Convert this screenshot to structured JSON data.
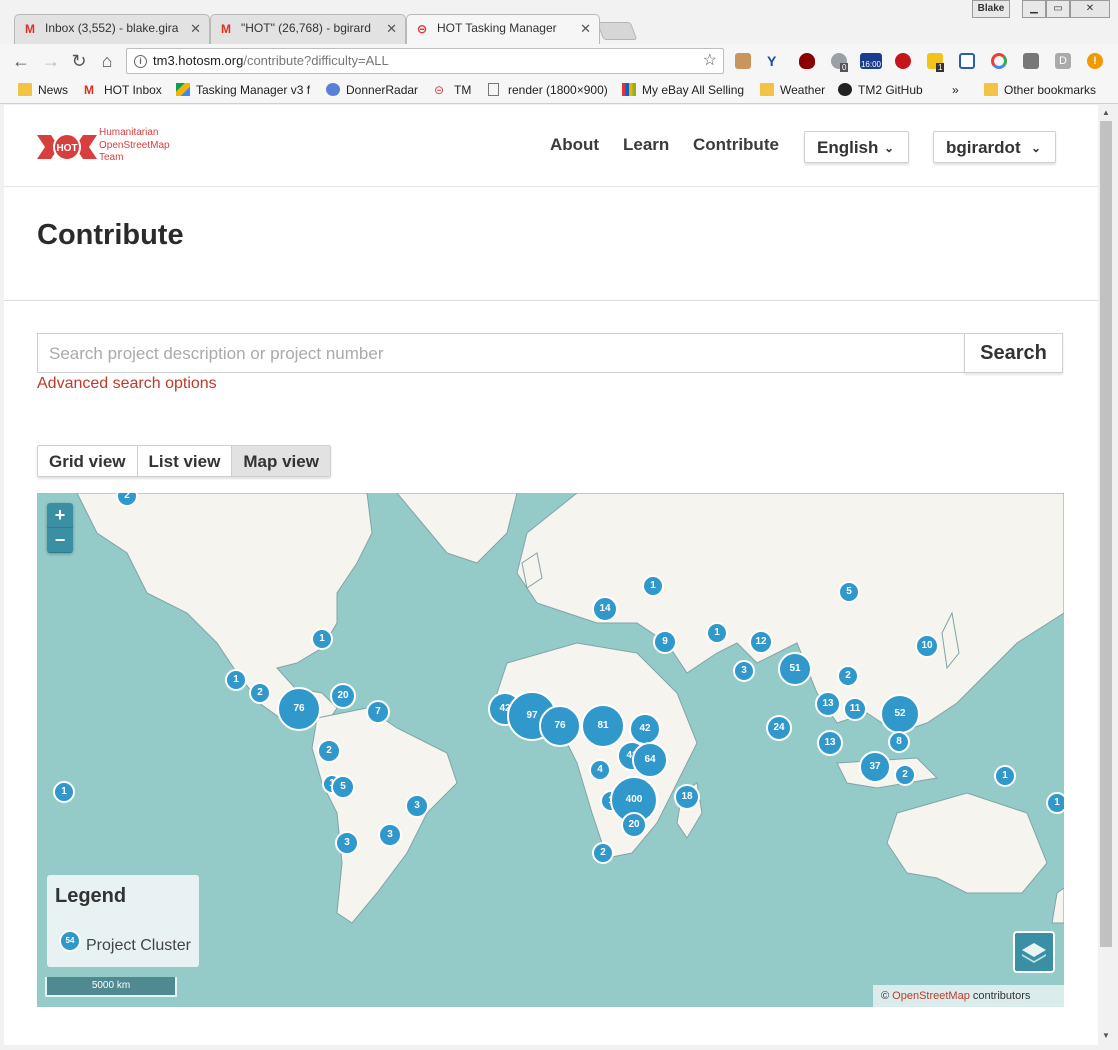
{
  "browser": {
    "tabs": [
      {
        "title": "Inbox (3,552) - blake.gira",
        "favicon": "gmail"
      },
      {
        "title": "\"HOT\" (26,768) - bgirard",
        "favicon": "gmail"
      },
      {
        "title": "HOT Tasking Manager",
        "favicon": "hot"
      }
    ],
    "user_badge": "Blake",
    "url_host": "tm3.hotosm.org",
    "url_path": "/contribute?difficulty=ALL",
    "bookmarks": [
      "News",
      "HOT Inbox",
      "Tasking Manager v3 f",
      "DonnerRadar",
      "TM",
      "render (1800×900)",
      "My eBay All Selling",
      "Weather",
      "TM2 GitHub",
      "»",
      "Other bookmarks"
    ],
    "ext_badges": {
      "counter": "0",
      "clock": "16:00",
      "notes": "1",
      "d": "D"
    }
  },
  "header": {
    "logo_text": [
      "Humanitarian",
      "OpenStreetMap",
      "Team"
    ],
    "logo_abbr": "HOT",
    "nav": [
      "About",
      "Learn",
      "Contribute"
    ],
    "language": "English",
    "user": "bgirardot"
  },
  "page": {
    "title": "Contribute",
    "search_placeholder": "Search project description or project number",
    "search_button": "Search",
    "advanced_link": "Advanced search options",
    "views": [
      "Grid view",
      "List view",
      "Map view"
    ],
    "active_view": "Map view"
  },
  "map": {
    "zoom_in": "+",
    "zoom_out": "−",
    "legend_title": "Legend",
    "legend_label": "Project Cluster",
    "legend_sample": "54",
    "scale": "5000 km",
    "attribution_prefix": "©",
    "attribution_link": "OpenStreetMap",
    "attribution_suffix": "contributors",
    "clusters": [
      "2",
      "1",
      "1",
      "2",
      "76",
      "20",
      "7",
      "2",
      "1",
      "5",
      "1",
      "3",
      "3",
      "3",
      "14",
      "1",
      "9",
      "1",
      "12",
      "3",
      "51",
      "5",
      "10",
      "2",
      "13",
      "11",
      "52",
      "24",
      "13",
      "8",
      "37",
      "2",
      "1",
      "42",
      "97",
      "76",
      "81",
      "42",
      "41",
      "64",
      "4",
      "1",
      "400",
      "20",
      "18",
      "2",
      "1"
    ]
  }
}
